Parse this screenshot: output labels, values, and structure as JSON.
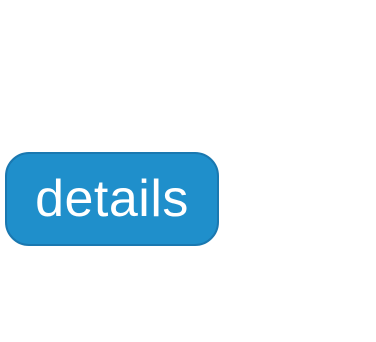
{
  "button": {
    "label": "details",
    "background_color": "#1f8fcb",
    "border_color": "#1a78b0",
    "text_color": "#ffffff"
  }
}
